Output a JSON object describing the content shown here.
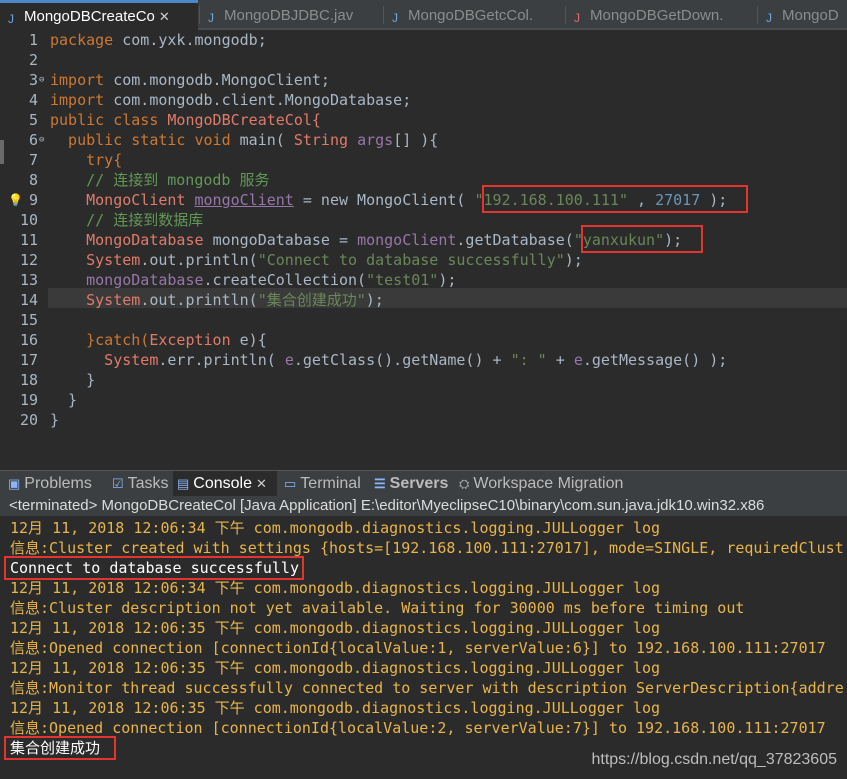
{
  "editor_tabs": [
    {
      "label": "MongoDBCreateCo",
      "active": true
    },
    {
      "label": "MongoDBJDBC.jav",
      "active": false
    },
    {
      "label": "MongoDBGetcCol.",
      "active": false
    },
    {
      "label": "MongoDBGetDown.",
      "active": false
    },
    {
      "label": "MongoD",
      "active": false
    }
  ],
  "line_numbers": [
    "1",
    "2",
    "3",
    "4",
    "5",
    "6",
    "7",
    "8",
    "9",
    "10",
    "11",
    "12",
    "13",
    "14",
    "15",
    "16",
    "17",
    "18",
    "19",
    "20"
  ],
  "code": {
    "l1a": "package",
    "l1b": " com.yxk.mongodb;",
    "l3a": "import",
    "l3b": " com.mongodb.MongoClient;",
    "l4a": "import",
    "l4b": " com.mongodb.client.MongoDatabase;",
    "l5a": "public class ",
    "l5b": "MongoDBCreateCol{",
    "l6a": "  public static void ",
    "l6b": "main( ",
    "l6c": "String ",
    "l6d": "args",
    "l6e": "[] ){",
    "l7": "    try{",
    "l8": "    // 连接到 mongodb 服务",
    "l9a": "    MongoClient ",
    "l9b": "mongoClient",
    "l9c": " = new MongoClient( ",
    "l9d": "\"192.168.100.111\"",
    "l9e": " , ",
    "l9f": "27017",
    "l9g": " );",
    "l10": "    // 连接到数据库",
    "l11a": "    MongoDatabase ",
    "l11b": "mongoDatabase = ",
    "l11c": "mongoClient",
    "l11d": ".getDatabase(",
    "l11e": "\"yanxukun\"",
    "l11f": ");",
    "l12a": "    System",
    "l12b": ".out.println(",
    "l12c": "\"Connect to database successfully\"",
    "l12d": ");",
    "l13a": "    mongoDatabase",
    "l13b": ".createCollection(",
    "l13c": "\"test01\"",
    "l13d": ");",
    "l14a": "    System",
    "l14b": ".out.println(",
    "l14c": "\"集合创建成功\"",
    "l14d": ");",
    "l16a": "    }catch(",
    "l16b": "Exception",
    "l16c": " e){",
    "l17a": "      System",
    "l17b": ".err.println( ",
    "l17c": "e",
    "l17d": ".getClass().getName() + ",
    "l17e": "\": \"",
    "l17f": " + ",
    "l17g": "e",
    "l17h": ".getMessage() );",
    "l18": "    }",
    "l19": "  }",
    "l20": "}"
  },
  "panel_tabs": [
    {
      "label": "Problems",
      "icon": "problems-icon"
    },
    {
      "label": "Tasks",
      "icon": "tasks-icon"
    },
    {
      "label": "Console",
      "icon": "console-icon",
      "active": true
    },
    {
      "label": "Terminal",
      "icon": "terminal-icon"
    },
    {
      "label": "Servers",
      "icon": "servers-icon"
    },
    {
      "label": "Workspace Migration",
      "icon": "migration-icon"
    }
  ],
  "console_header": "<terminated> MongoDBCreateCol [Java Application] E:\\editor\\MyeclipseC10\\binary\\com.sun.java.jdk10.win32.x86",
  "console_lines": [
    "12月 11, 2018 12:06:34 下午 com.mongodb.diagnostics.logging.JULLogger log",
    "信息:Cluster created with settings {hosts=[192.168.100.111:27017], mode=SINGLE, requiredClust",
    "Connect to database successfully",
    "12月 11, 2018 12:06:34 下午 com.mongodb.diagnostics.logging.JULLogger log",
    "信息:Cluster description not yet available. Waiting for 30000 ms before timing out",
    "12月 11, 2018 12:06:35 下午 com.mongodb.diagnostics.logging.JULLogger log",
    "信息:Opened connection [connectionId{localValue:1, serverValue:6}] to 192.168.100.111:27017",
    "12月 11, 2018 12:06:35 下午 com.mongodb.diagnostics.logging.JULLogger log",
    "信息:Monitor thread successfully connected to server with description ServerDescription{addre",
    "12月 11, 2018 12:06:35 下午 com.mongodb.diagnostics.logging.JULLogger log",
    "信息:Opened connection [connectionId{localValue:2, serverValue:7}] to 192.168.100.111:27017",
    "集合创建成功"
  ],
  "watermark": "https://blog.csdn.net/qq_37823605",
  "colors": {
    "highlight_box": "#e3342f",
    "log_text": "#e8b54a",
    "stdout_text": "#ffffff"
  }
}
